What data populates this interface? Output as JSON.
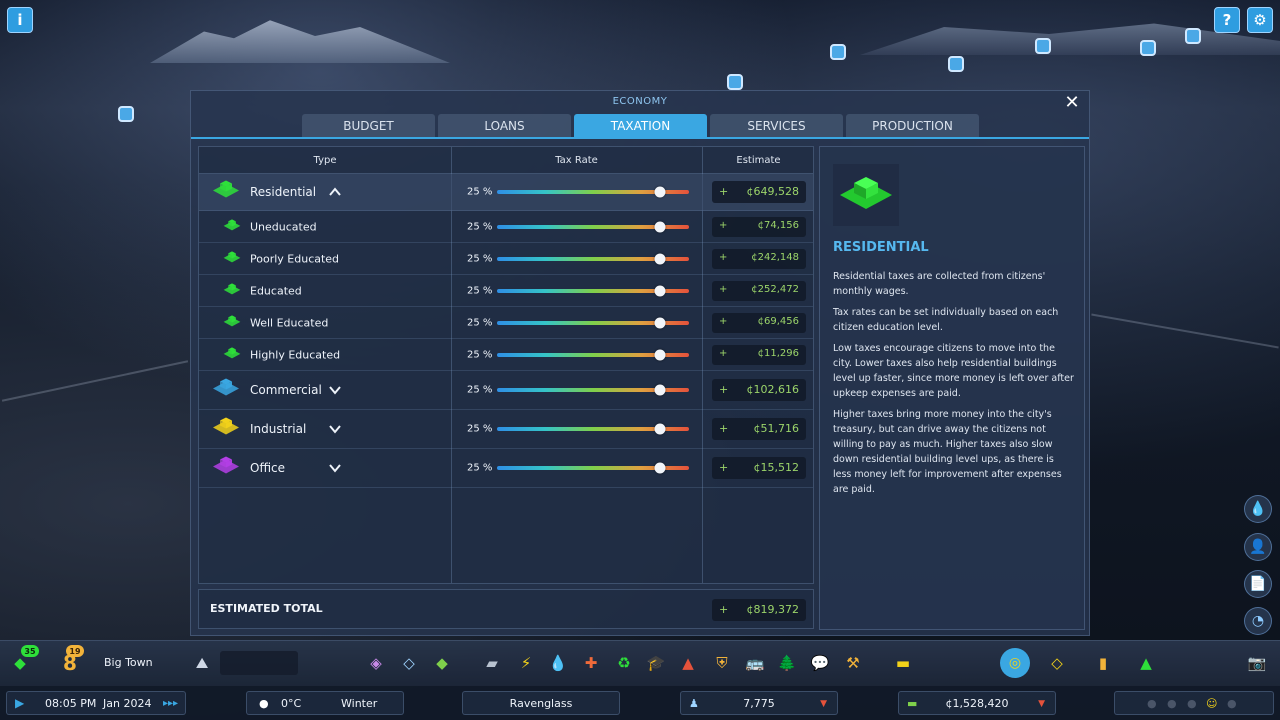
{
  "panel": {
    "title": "ECONOMY",
    "close": "✕",
    "tabs": [
      {
        "label": "BUDGET",
        "active": false
      },
      {
        "label": "LOANS",
        "active": false
      },
      {
        "label": "TAXATION",
        "active": true
      },
      {
        "label": "SERVICES",
        "active": false
      },
      {
        "label": "PRODUCTION",
        "active": false
      }
    ]
  },
  "table": {
    "headers": {
      "type": "Type",
      "rate": "Tax Rate",
      "estimate": "Estimate"
    },
    "rows": [
      {
        "label": "Residential",
        "rate": "25 %",
        "rate_value": 0.85,
        "plus": "+",
        "estimate": "¢649,528",
        "kind": "main",
        "expanded": true,
        "icon": "residential-icon",
        "color": "#2ee03a"
      },
      {
        "label": "Uneducated",
        "rate": "25 %",
        "rate_value": 0.85,
        "plus": "+",
        "estimate": "¢74,156",
        "kind": "sub",
        "icon": "residential-icon",
        "color": "#2ee03a"
      },
      {
        "label": "Poorly Educated",
        "rate": "25 %",
        "rate_value": 0.85,
        "plus": "+",
        "estimate": "¢242,148",
        "kind": "sub",
        "icon": "residential-icon",
        "color": "#2ee03a"
      },
      {
        "label": "Educated",
        "rate": "25 %",
        "rate_value": 0.85,
        "plus": "+",
        "estimate": "¢252,472",
        "kind": "sub",
        "icon": "residential-icon",
        "color": "#2ee03a"
      },
      {
        "label": "Well Educated",
        "rate": "25 %",
        "rate_value": 0.85,
        "plus": "+",
        "estimate": "¢69,456",
        "kind": "sub",
        "icon": "residential-icon",
        "color": "#2ee03a"
      },
      {
        "label": "Highly Educated",
        "rate": "25 %",
        "rate_value": 0.85,
        "plus": "+",
        "estimate": "¢11,296",
        "kind": "sub",
        "icon": "residential-icon",
        "color": "#2ee03a"
      },
      {
        "label": "Commercial",
        "rate": "25 %",
        "rate_value": 0.85,
        "plus": "+",
        "estimate": "¢102,616",
        "kind": "main",
        "expanded": false,
        "icon": "commercial-icon",
        "color": "#3aa7e2"
      },
      {
        "label": "Industrial",
        "rate": "25 %",
        "rate_value": 0.85,
        "plus": "+",
        "estimate": "¢51,716",
        "kind": "main",
        "expanded": false,
        "icon": "industrial-icon",
        "color": "#f2d21a"
      },
      {
        "label": "Office",
        "rate": "25 %",
        "rate_value": 0.85,
        "plus": "+",
        "estimate": "¢15,512",
        "kind": "main",
        "expanded": false,
        "icon": "office-icon",
        "color": "#b33ee6"
      }
    ],
    "total_label": "ESTIMATED TOTAL",
    "total_plus": "+",
    "total_value": "¢819,372"
  },
  "info": {
    "title": "RESIDENTIAL",
    "paragraphs": [
      "Residential taxes are collected from citizens' monthly wages.",
      "Tax rates can be set individually based on each citizen education level.",
      "Low taxes encourage citizens to move into the city. Lower taxes also help residential buildings level up faster, since more money is left over after upkeep expenses are paid.",
      "Higher taxes bring more money into the city's treasury, but can drive away the citizens not willing to pay as much. Higher taxes also slow down residential building level ups, as there is less money left for improvement after expenses are paid."
    ]
  },
  "toolbar": {
    "milestone_badge": "35",
    "level_badge": "19",
    "level_number": "8",
    "town_name": "Big Town"
  },
  "status": {
    "time": "08:05 PM",
    "date": "Jan 2024",
    "temperature": "0°C",
    "season": "Winter",
    "city_name": "Ravenglass",
    "population": "7,775",
    "money": "¢1,528,420"
  },
  "colors": {
    "accent": "#3aa7e2",
    "money_green": "#9bd46a",
    "info_title": "#56b8ef"
  }
}
